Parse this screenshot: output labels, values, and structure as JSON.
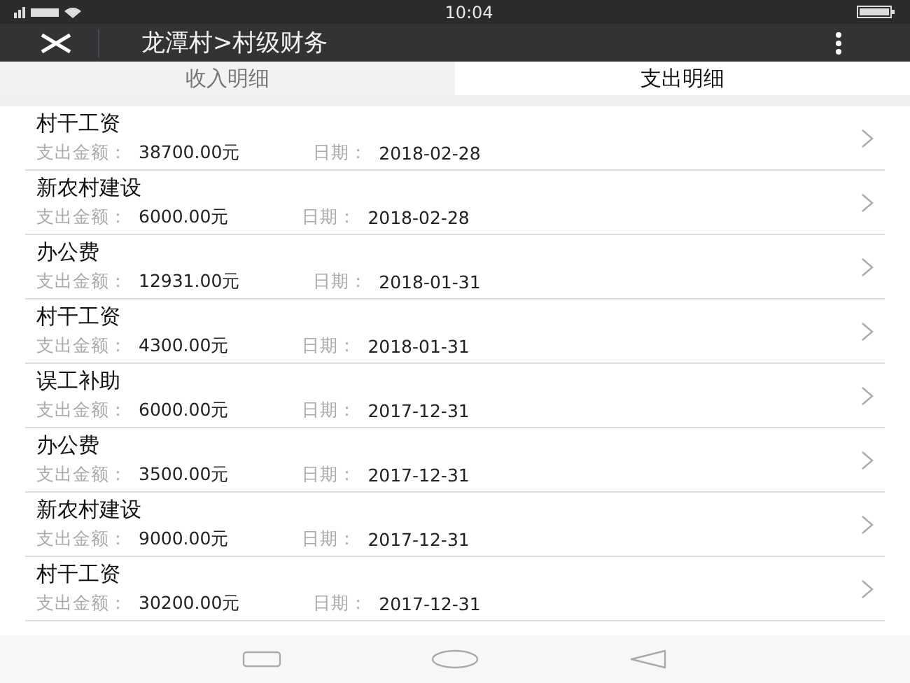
{
  "status_bar": {
    "time": "10:04"
  },
  "header": {
    "title": "龙潭村>村级财务"
  },
  "tabs": [
    {
      "label": "收入明细",
      "selected": false
    },
    {
      "label": "支出明细",
      "selected": true
    }
  ],
  "records": [
    {
      "title": "村干工资",
      "amount_label": "支出金额：",
      "amount": "38700.00元",
      "date_label": "日期：",
      "date": "2018-02-28"
    },
    {
      "title": "新农村建设",
      "amount_label": "支出金额：",
      "amount": "6000.00元",
      "date_label": "日期：",
      "date": "2018-02-28"
    },
    {
      "title": "办公费",
      "amount_label": "支出金额：",
      "amount": "12931.00元",
      "date_label": "日期：",
      "date": "2018-01-31"
    },
    {
      "title": "村干工资",
      "amount_label": "支出金额：",
      "amount": "4300.00元",
      "date_label": "日期：",
      "date": "2018-01-31"
    },
    {
      "title": "误工补助",
      "amount_label": "支出金额：",
      "amount": "6000.00元",
      "date_label": "日期：",
      "date": "2017-12-31"
    },
    {
      "title": "办公费",
      "amount_label": "支出金额：",
      "amount": "3500.00元",
      "date_label": "日期：",
      "date": "2017-12-31"
    },
    {
      "title": "新农村建设",
      "amount_label": "支出金额：",
      "amount": "9000.00元",
      "date_label": "日期：",
      "date": "2017-12-31"
    },
    {
      "title": "村干工资",
      "amount_label": "支出金额：",
      "amount": "30200.00元",
      "date_label": "日期：",
      "date": "2017-12-31"
    }
  ]
}
